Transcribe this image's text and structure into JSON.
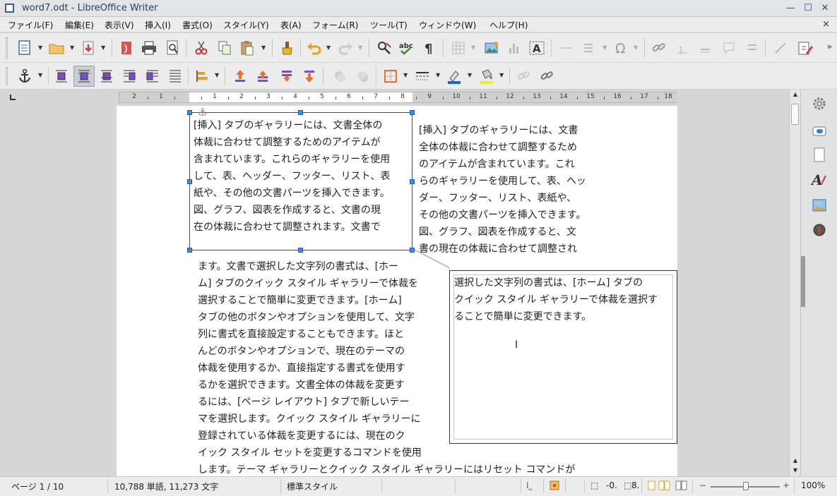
{
  "window": {
    "title": "word7.odt - LibreOffice Writer",
    "min": "—",
    "max": "☐",
    "close": "✕"
  },
  "menu": {
    "items": [
      "ファイル(F)",
      "編集(E)",
      "表示(V)",
      "挿入(I)",
      "書式(O)",
      "スタイル(Y)",
      "表(A)",
      "フォーム(R)",
      "ツール(T)",
      "ウィンドウ(W)",
      "ヘルプ(H)"
    ],
    "close": "×"
  },
  "toolbar": {
    "more": "»"
  },
  "ruler": {
    "numbers": [
      "2",
      "1",
      "1",
      "2",
      "3",
      "4",
      "5",
      "6",
      "7",
      "8",
      "9",
      "10",
      "11",
      "12",
      "13",
      "14",
      "15",
      "16",
      "17",
      "18"
    ]
  },
  "document": {
    "frame1_lines": [
      "[挿入] タブのギャラリーには、文書全体の",
      "体裁に合わせて調整するためのアイテムが",
      "含まれています。これらのギャラリーを使用",
      "して、表、ヘッダー、フッター、リスト、表",
      "紙や、その他の文書パーツを挿入できます。",
      "図、グラフ、図表を作成すると、文書の現",
      "在の体裁に合わせて調整されます。文書で"
    ],
    "right_column_lines": [
      "[挿入] タブのギャラリーには、文書",
      "全体の体裁に合わせて調整するため",
      "のアイテムが含まれています。これ",
      "らのギャラリーを使用して、表、ヘッ",
      "ダー、フッター、リスト、表紙や、",
      "その他の文書パーツを挿入できます。",
      "図、グラフ、図表を作成すると、文",
      "書の現在の体裁に合わせて調整され"
    ],
    "body_lines": [
      "ます。文書で選択した文字列の書式は、[ホー",
      "ム] タブのクイック スタイル ギャラリーで体裁を",
      "選択することで簡単に変更できます。[ホーム]",
      "タブの他のボタンやオプションを使用して、文字",
      "列に書式を直接設定することもできます。ほと",
      "んどのボタンやオプションで、現在のテーマの",
      "体裁を使用するか、直接指定する書式を使用す",
      "るかを選択できます。文書全体の体裁を変更す",
      "るには、[ページ レイアウト] タブで新しいテー",
      "マを選択します。クイック スタイル ギャラリーに",
      "登録されている体裁を変更するには、現在のク",
      "イック スタイル セットを変更するコマンドを使用",
      "します。テーマ ギャラリーとクイック スタイル ギャラリーにはリセット コマンドが"
    ],
    "frame2_lines": [
      "選択した文字列の書式は、[ホーム] タブの",
      "クイック スタイル ギャラリーで体裁を選択す",
      "ることで簡単に変更できます。"
    ]
  },
  "statusbar": {
    "page": "ページ 1 / 10",
    "words": "10,788 単語, 11,273 文字",
    "style": "標準スタイル",
    "position": "-0.",
    "size": "8.",
    "zoom": "100%"
  }
}
